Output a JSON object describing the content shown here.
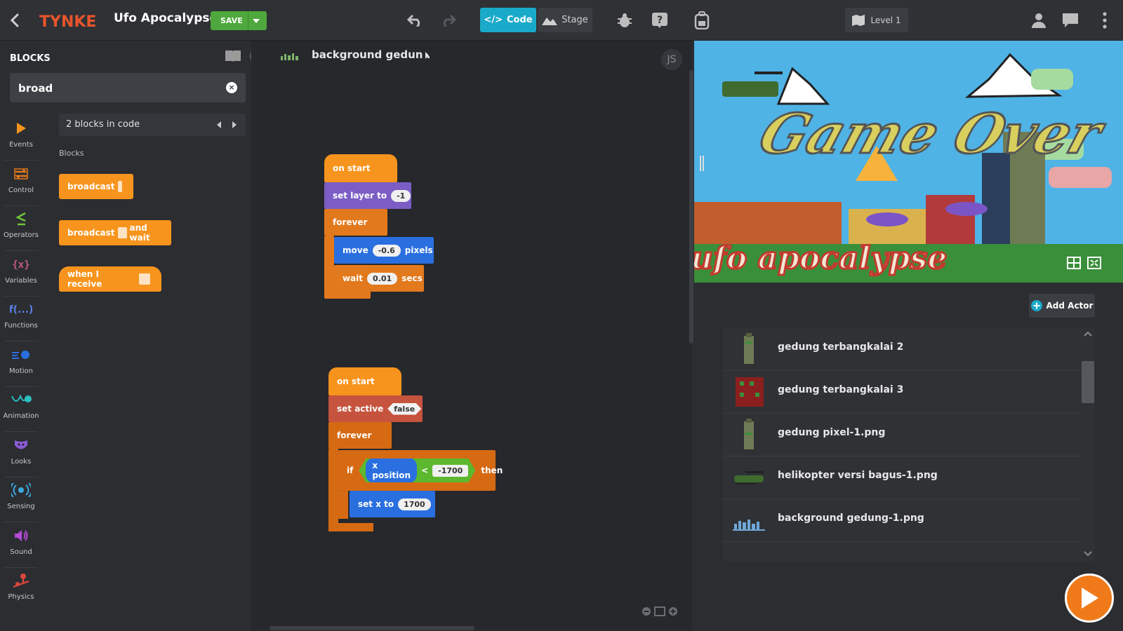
{
  "app": {
    "logo_text": "TYNKER",
    "project_title": "Ufo Apocalypse",
    "save_label": "SAVE",
    "code_tab": "Code",
    "stage_tab": "Stage",
    "level_label": "Level 1"
  },
  "blocks_panel": {
    "title": "BLOCKS",
    "search_value": "broad",
    "results_text": "2 blocks in code",
    "subheading": "Blocks",
    "palette": [
      {
        "label": "broadcast"
      },
      {
        "label_before": "broadcast",
        "label_after": "and wait"
      },
      {
        "label": "when I receive"
      }
    ],
    "categories": [
      {
        "label": "Events",
        "color": "#f7941d",
        "icon": "play-icon"
      },
      {
        "label": "Control",
        "color": "#e2791c",
        "icon": "loop-icon"
      },
      {
        "label": "Operators",
        "color": "#6fc43a",
        "icon": "operator-icon"
      },
      {
        "label": "Variables",
        "color": "#c45c7c",
        "icon": "variable-icon"
      },
      {
        "label": "Functions",
        "color": "#5b7fe0",
        "icon": "function-icon"
      },
      {
        "label": "Motion",
        "color": "#2a6fe0",
        "icon": "motion-icon"
      },
      {
        "label": "Animation",
        "color": "#2bbfbf",
        "icon": "animation-icon"
      },
      {
        "label": "Looks",
        "color": "#8a5cd8",
        "icon": "looks-icon"
      },
      {
        "label": "Sensing",
        "color": "#3aa9e0",
        "icon": "sensing-icon"
      },
      {
        "label": "Sound",
        "color": "#b44bd8",
        "icon": "sound-icon"
      },
      {
        "label": "Physics",
        "color": "#d8473b",
        "icon": "physics-icon"
      }
    ]
  },
  "code_area": {
    "breadcrumb": "background gedun .",
    "js_label": "JS",
    "script1": {
      "hat": "on start",
      "set_layer": "set layer to",
      "layer_value": "-1",
      "forever": "forever",
      "move": "move",
      "move_value": "-0.6",
      "move_unit": "pixels",
      "wait": "wait",
      "wait_value": "0.01",
      "wait_unit": "secs"
    },
    "script2": {
      "hat": "on start",
      "set_active": "set active",
      "active_value": "false",
      "forever": "forever",
      "if": "if",
      "x_position": "x position",
      "operator": "<",
      "compare_value": "-1700",
      "then": "then",
      "set_x": "set x to",
      "set_x_value": "1700"
    }
  },
  "stage": {
    "add_actor": "Add Actor",
    "game_over_text": "Game Over",
    "banner_text": "ufo apocalypse",
    "actors": [
      {
        "name": "gedung terbangkalai 2"
      },
      {
        "name": "gedung terbangkalai 3"
      },
      {
        "name": "gedung pixel-1.png"
      },
      {
        "name": "helikopter versi bagus-1.png"
      },
      {
        "name": "background gedung-1.png"
      }
    ]
  },
  "colors": {
    "accent": "#1aaac9",
    "save": "#4fa83d",
    "play": "#f07a1a"
  }
}
